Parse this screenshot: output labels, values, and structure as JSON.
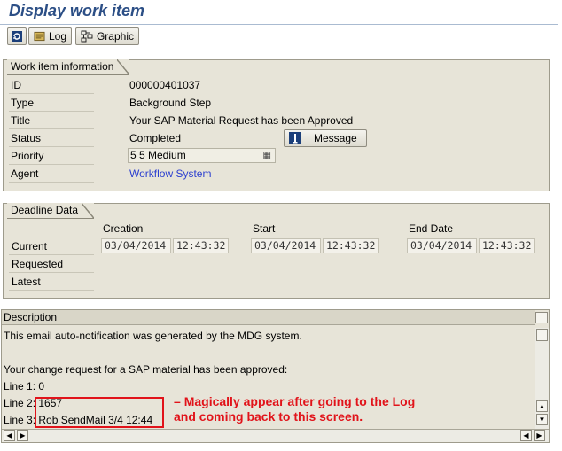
{
  "window": {
    "title": "Display work item"
  },
  "toolbar": {
    "refresh_icon": "refresh-icon",
    "log_label": "Log",
    "graphic_label": "Graphic"
  },
  "work_item": {
    "section_title": "Work item information",
    "id_label": "ID",
    "id_value": "000000401037",
    "type_label": "Type",
    "type_value": "Background Step",
    "title_label": "Title",
    "title_value": "Your SAP Material Request has been Approved",
    "status_label": "Status",
    "status_value": "Completed",
    "message_button": "Message",
    "priority_label": "Priority",
    "priority_value": "5 5 Medium",
    "agent_label": "Agent",
    "agent_value": "Workflow System"
  },
  "deadline": {
    "section_title": "Deadline Data",
    "col_creation": "Creation",
    "col_start": "Start",
    "col_end": "End Date",
    "row_current": "Current",
    "row_requested": "Requested",
    "row_latest": "Latest",
    "current": {
      "creation_date": "03/04/2014",
      "creation_time": "12:43:32",
      "start_date": "03/04/2014",
      "start_time": "12:43:32",
      "end_date": "03/04/2014",
      "end_time": "12:43:32"
    }
  },
  "description": {
    "header": "Description",
    "lines": [
      "This email auto-notification was generated by the MDG system.",
      "",
      "Your change request for a SAP material has been approved:",
      "Line 1: 0",
      "Line 2: 1657",
      "Line 3: Rob SendMail 3/4 12:44"
    ]
  },
  "annotation": {
    "line1": "Magically appear after going to the Log",
    "line2": "and coming back to this screen.",
    "color": "#e1131a"
  }
}
